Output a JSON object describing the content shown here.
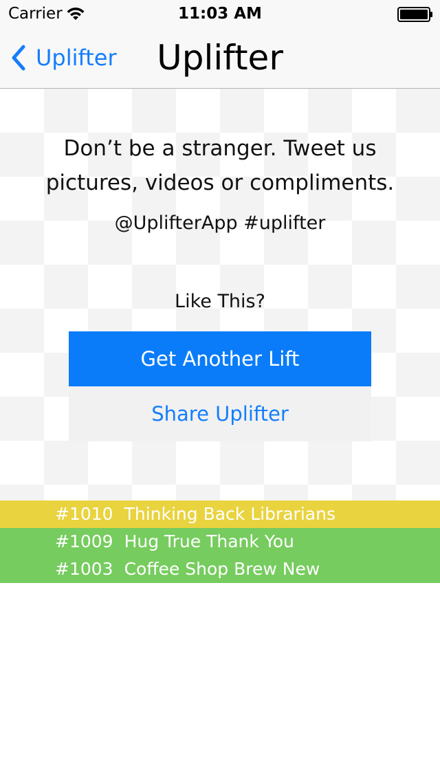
{
  "status_bar": {
    "carrier": "Carrier",
    "time": "11:03 AM",
    "wifi_icon": "wifi-icon",
    "battery_icon": "battery-icon"
  },
  "nav": {
    "back_label": "Uplifter",
    "back_icon": "chevron-left-icon",
    "title": "Uplifter"
  },
  "main": {
    "invite_line1": "Don’t be a stranger.  Tweet us",
    "invite_line2": "pictures, videos or compliments.",
    "handle": "@UplifterApp #uplifter",
    "like_prompt": "Like This?",
    "primary_button": "Get Another Lift",
    "secondary_button": "Share Uplifter"
  },
  "history": [
    {
      "number": "#1010",
      "title": "Thinking Back Librarians",
      "color": "#e9d33f"
    },
    {
      "number": "#1009",
      "title": "Hug True Thank You",
      "color": "#76cc5e"
    },
    {
      "number": "#1003",
      "title": "Coffee Shop Brew New",
      "color": "#76cc5e"
    }
  ],
  "colors": {
    "accent": "#147efb",
    "primary_button_bg": "#0a7cfa",
    "secondary_button_bg": "#f1f1f1"
  }
}
